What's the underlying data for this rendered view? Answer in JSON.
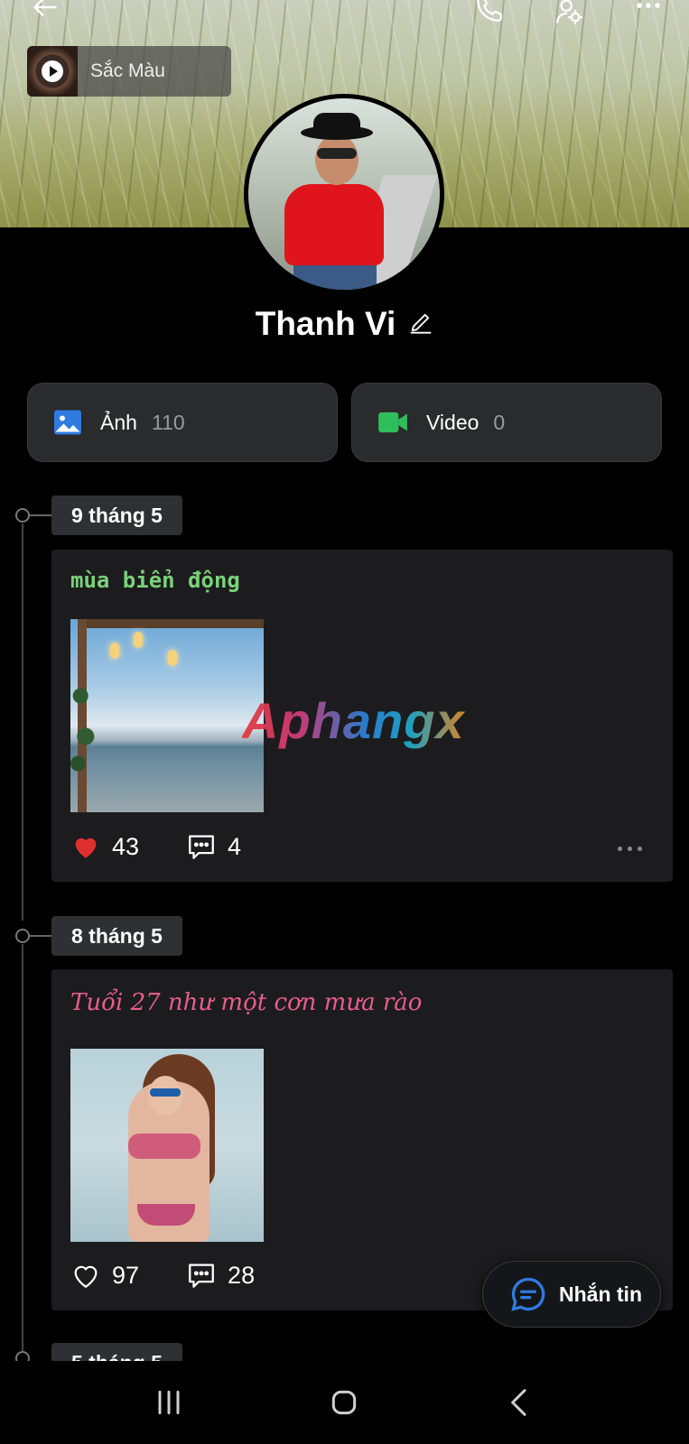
{
  "header": {
    "music": {
      "title": "Sắc Màu"
    }
  },
  "profile": {
    "name": "Thanh Vi"
  },
  "media": {
    "photos": {
      "label": "Ảnh",
      "count": "110"
    },
    "videos": {
      "label": "Video",
      "count": "0"
    }
  },
  "timeline": {
    "groups": [
      {
        "date": "9 tháng 5",
        "post": {
          "text": "mùa biển động",
          "likes": "43",
          "comments": "4",
          "liked": true
        }
      },
      {
        "date": "8 tháng 5",
        "post": {
          "text": "Tuổi 27 như một cơn mưa rào",
          "likes": "97",
          "comments": "28",
          "liked": false
        }
      },
      {
        "date": "5 tháng 5"
      }
    ]
  },
  "watermark": "Aphangx",
  "fab": {
    "label": "Nhắn tin"
  },
  "colors": {
    "accent_blue": "#2f7be0",
    "video_green": "#2fbf5a",
    "like_red": "#e0302e",
    "post_green_text": "#7ad279",
    "post_pink_text": "#e85d8a"
  }
}
